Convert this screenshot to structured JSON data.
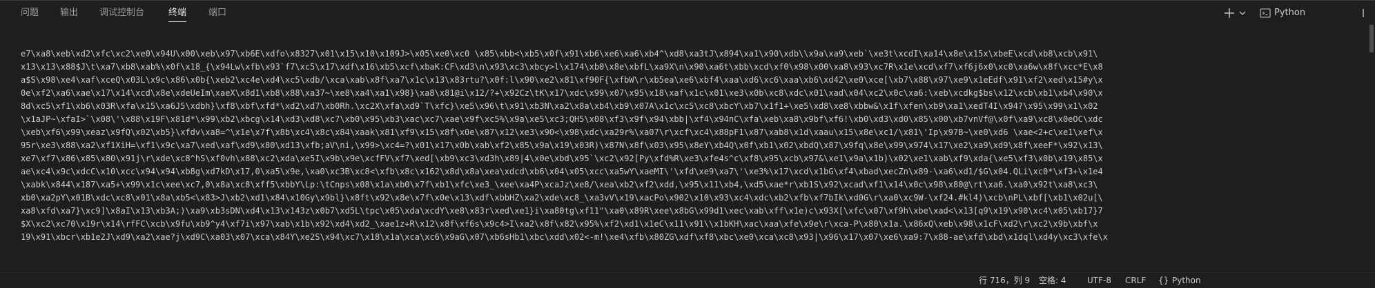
{
  "tabs": [
    {
      "label": "问题"
    },
    {
      "label": "输出"
    },
    {
      "label": "调试控制台"
    },
    {
      "label": "终端"
    },
    {
      "label": "端口"
    }
  ],
  "actions": {
    "new_terminal_icon": "plus-icon",
    "dropdown_icon": "chevron-down-icon",
    "profile_label": "Python",
    "profile_icon": "terminal-icon"
  },
  "terminal_lines": [
    "e7\\xa8\\xeb\\xd2\\xfc\\xc2\\xe0\\x94U\\x00\\xeb\\x97\\xb6E\\xdfo\\x8327\\x01\\x15\\x10\\x109J>\\x05\\xe0\\xc0 \\x85\\xbb<\\xb5\\x0f\\x91\\xb6\\xe6\\xa6\\xb4^\\xd8\\xa3tJ\\x894\\xa1\\x90\\xdb\\\\x9a\\xa9\\xeb`\\xe3t\\xcdI\\xa14\\x8e\\x15x\\xbeE\\xcd\\xb8\\xcb\\x91\\",
    "x13\\x13\\x88$J\\t\\xa7\\xb8\\xab%\\x0f\\x18_{\\x94Lw\\xfb\\x93`f7\\xc5\\x17\\xdf\\x16\\xb5\\xcf\\xbaK:CF\\xd3\\n\\x93\\xc3\\xbcy>l\\x174\\xb0\\x8e\\xbfL\\xa9X\\n\\x90\\xa6t\\xbb\\xcd\\xf0\\x98\\x00\\xa8\\x93\\xc7R\\x1e\\xcd\\xf7\\xf6j6x0\\xc0\\xa6w\\x8f\\xcc*E\\x8",
    "a$S\\x98\\xe4\\xaf\\xceQ\\x03L\\x9c\\x86\\x0b{\\xeb2\\xc4e\\xd4\\xc5\\xdb/\\xca\\xab\\x8f\\xa7\\x1c\\x13\\x83rtu?\\x0f:l\\x90\\xe2\\x81\\xf90F{\\xfbW\\r\\xb5ea\\xe6\\xbf4\\xaa\\xd6\\xc6\\xaa\\xb6\\xd42\\xe0\\xce[\\xb7\\x88\\x97\\xe9\\x1eEdf\\x91\\xf2\\xed\\x15#y\\x",
    "0e\\xf2\\xa6\\xae\\x17\\x14\\xcd\\x8e\\xdeUeIm\\xaeX\\x8d1\\xb8\\x88\\xa37~\\xe8\\xa4\\xa1\\x98}\\xa8\\x81@i\\x12/?+\\x92Cz\\tK\\x17\\xdc\\x99\\x07\\x95\\x18\\xaf\\x1c\\x01\\xe3\\x0b\\xc8\\xdc\\x01\\xad\\x04\\xc2\\x0c\\xa6:\\xeb\\xcdkg$bs\\x12\\xcb\\xb1\\xb4\\x90\\x",
    "8d\\xc5\\xf1\\xb6\\x03R\\xfa\\x15\\xa6J5\\xdbh}\\xf8\\xbf\\xfd*\\xd2\\xd7\\xb0Rh.\\xc2X\\xfa\\xd9`T\\xfc}\\xe5\\x96\\t\\x91\\xb3N\\xa2\\x8a\\xb4\\xb9\\x07A\\x1c\\xc5\\xc8\\xbcY\\xb7\\x1f1+\\xe5\\xd8\\xe8\\xbbw&\\x1f\\xfen\\xb9\\xa1\\xedT4I\\x94?\\x95\\x99\\x1\\x02",
    "\\x1aJP~\\xfaI>`\\x08\\'\\x88\\x19F\\x81d*\\x99\\xb2\\xbcg\\x14\\xd3\\xd8\\xc7\\xb0\\x95\\xb3\\xac\\xc7\\xae\\x9f\\xc5%\\x9a\\xe5\\xc3;QH5\\x08\\xf3\\x9f\\x94\\xbb|\\xf4\\x94nC\\xfa\\xeb\\xa8\\x9bf\\xf6!\\xb0\\xd3\\xd0\\x85\\x00\\xb7vnVf@\\x0f\\xa9\\xc8\\x0eOC\\xdc",
    "\\xeb\\xf6\\x99\\xeaz\\x9fQ\\x02\\xb5}\\xfdv\\xa8=^\\x1e\\x7f\\x8b\\xc4\\x8c\\x84\\xaak\\x81\\xf9\\x15\\x8f\\x0e\\x87\\x12\\xe3\\x90<\\x98\\xdc\\xa29r%\\xa07\\r\\xcf\\xc4\\x88pF1\\x87\\xab8\\x1d\\xaau\\x15\\x8e\\xc1/\\x81\\'Ip\\x97B~\\xe0\\xd6 \\xae<2+c\\xe1\\xef\\x",
    "95r\\xe3\\x88\\xa2\\xf1XiH=\\xf1\\x9c\\xa7\\xed\\xaf\\xd9\\x80\\xd13\\xfb;aV\\ni,\\x99>\\xc4=?\\x01\\x17\\x0b\\xab\\xf2\\x85\\x9a\\x19\\x03R)\\x87N\\x8f\\x03\\x95\\x8eY\\xb4Q\\x0f\\xb1\\x02\\xbdQ\\x87\\x9fq\\x8e\\x99\\x974\\x17\\xe2\\xa9\\xd9\\x8f\\xeeF*\\x92\\x13\\",
    "xe7\\xf7\\x86\\x85\\x80\\x91j\\r\\xde\\xc8^hS\\xf0vh\\x88\\xc2\\xda\\xe5I\\x9b\\x9e\\xcfFV\\xf7\\xed[\\xb9\\xc3\\xd3h\\x89|4\\x0e\\xbd\\x95`\\xc2\\x92[Py\\xfd%R\\xe3\\xfe4s^c\\xf8\\x95\\xcb\\x97&\\xe1\\x9a\\x1b)\\x02\\xe1\\xab\\xf9\\xda{\\xe5\\xf3\\x0b\\x19\\x85\\x",
    "ae\\xc4\\x9c\\xdcC\\x10\\xcc\\x94\\x94\\xb8g\\xd7kD\\x17,0\\xa5\\x9e,\\xa0\\xc3B\\xc8<\\xfb\\x8c\\x162\\x8d\\x8a\\xea\\xdcd\\xb6\\x04\\x05\\xcc\\xa5wY\\xaeMI\\'\\xfd\\xe9\\xa7\\'\\xe3%\\x17\\xcd\\x1bG\\xf4\\xbad\\xecZn\\x89-\\xa6\\xd1/$G\\x04.QLi\\xc0*\\xf3+\\x1e4",
    "\\xabk\\x844\\x187\\xa5+\\x99\\x1c\\xee\\xc7,0\\x8a\\xc8\\xff5\\xbbY\\Lp:\\tCnps\\x08\\x1a\\xb0\\x7f\\xb1\\xfc\\xe3_\\xee\\xa4P\\xcaJz\\xe8/\\xea\\xb2\\xf2\\xdd,\\x95\\x11\\xb4,\\xd5\\xae*r\\xb1S\\x92\\xcad\\xf1\\x14\\x0c\\x98\\x80@\\rt\\xa6.\\xa0\\x92t\\xa8\\xc3\\",
    "xb0\\xa2pY\\x01B\\xdc\\xc8\\x01\\x8a\\xb5<\\x83>J\\xb2\\xd1\\x84\\x10Gy\\x9bl}\\x8ft\\x92\\x8e\\x7f\\x0e\\x13\\xdf\\xbbHZ\\xa2\\xde\\xc8_\\xa3vV\\x19\\xacPo\\x902\\x10\\x93\\xc4\\xdc\\xb2\\xfb\\xf7bIk\\xd0G\\r\\xa0\\xc9W-\\xf24.#kl4)\\xcb\\nPL\\xbf[\\xb1\\x02u[\\",
    "xa8\\xfd\\xa7}\\xc9]\\x8aI\\x13\\xb3A;)\\xa9\\xb3sDN\\xd4\\x13\\x143z\\x0b7\\xd5L\\tpc\\x05\\xda\\xcdY\\xe8\\x83r\\xed\\xe1}i\\xa80tg\\xf11\"\\xa0\\x89R\\xee\\x8bG\\x99d1\\xec\\xab\\xff\\x1e)c\\x93X[\\xfc\\x07\\xf9h\\xbe\\xad<\\x13[q9\\x19\\x90\\xc4\\x05\\xb17}7",
    "$X\\xc2\\xc70\\x19r\\x14\\rfFC\\xcb\\x9fu\\xb9^y4\\xf7i\\x97\\xab\\x1b\\x92\\xd4\\xd2_\\xae1z+R\\x12\\x8f\\xf6s\\x9c4>I\\xa2\\x8f\\x82\\x95%\\xf2\\xd1\\x1eC\\x11\\x91\\\\x1bKH\\xac\\xaa\\xfe\\x9e\\r\\xca-P\\x80\\x1a.\\x86xQ\\xeb\\x98\\x1cF\\xd2\\r\\xc2\\x9b\\xbf\\x",
    "19\\x91\\xbcr\\xb1e2J\\xd9\\xa2\\xae?j\\xd9C\\xa03\\x07\\xca\\x84Y\\xe2S\\x94\\xc7\\x18\\x1a\\xca\\xc6\\x9aG\\x07\\xb6sHb1\\xbc\\xdd\\x02<-m!\\xe4\\xfb\\x80ZG\\xdf\\xf8\\xbc\\xe0\\xca\\xc8\\x93|\\x96\\x17\\x07\\xe6\\xa9:7\\x88-ae\\xfd\\xbd\\x1dql\\xd4y\\xc3\\xfe\\x"
  ],
  "status": {
    "position": "行 716，列 9",
    "indent": "空格: 4",
    "encoding": "UTF-8",
    "eol": "CRLF",
    "language_icon": "braces-icon",
    "language": "Python"
  }
}
